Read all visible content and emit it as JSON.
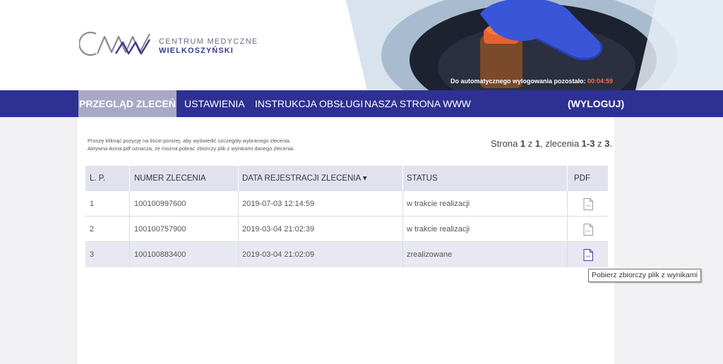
{
  "logo": {
    "line1": "CENTRUM MEDYCZNE",
    "line2": "WIELKOSZYŃSKI"
  },
  "header": {
    "timer_label": "Do automatycznego wylogowania pozostało: ",
    "timer_value": "00:04:59"
  },
  "nav": {
    "items": [
      "PRZEGLĄD ZLECEŃ",
      "USTAWIENIA",
      "INSTRUKCJA OBSŁUGI",
      "NASZA STRONA WWW"
    ],
    "logout": "(WYLOGUJ)"
  },
  "info": {
    "line1": "Proszę kliknąć pozycję na liście poniżej, aby wyświetlić szczegóły wybranego zlecenia.",
    "line2": "Aktywna ikona pdf oznacza, że można pobrać zbiorczy plik z wynikami danego zlecenia."
  },
  "paging": {
    "prefix": "Strona ",
    "page": "1",
    "of": " z ",
    "pages": "1",
    "orders_label": ", zlecenia ",
    "range": "1-3",
    "total_of": " z ",
    "total": "3",
    "end": "."
  },
  "table": {
    "headers": [
      "L. P.",
      "NUMER ZLECENIA",
      "DATA REJESTRACJI ZLECENIA",
      "STATUS",
      "PDF"
    ],
    "sort_icon": "▾",
    "rows": [
      {
        "lp": "1",
        "number": "100100997600",
        "date": "2019-07-03 12:14:59",
        "status": "w trakcie realizacji",
        "pdf_icon": "pdf-icon",
        "pdf_active": false
      },
      {
        "lp": "2",
        "number": "100100757900",
        "date": "2019-03-04 21:02:39",
        "status": "w trakcie realizacji",
        "pdf_icon": "pdf-icon",
        "pdf_active": false
      },
      {
        "lp": "3",
        "number": "100100883400",
        "date": "2019-03-04 21:02:09",
        "status": "zrealizowane",
        "pdf_icon": "pdf-icon",
        "pdf_active": true
      }
    ]
  },
  "tooltip": "Pobierz zbiorczy plik z wynikami",
  "colors": {
    "nav_bg": "#2e3192",
    "nav_active": "#a8a9c6",
    "timer_value": "#ff6b4a",
    "pdf_active": "#3b3b9a",
    "pdf_inactive": "#9a9a9a"
  }
}
